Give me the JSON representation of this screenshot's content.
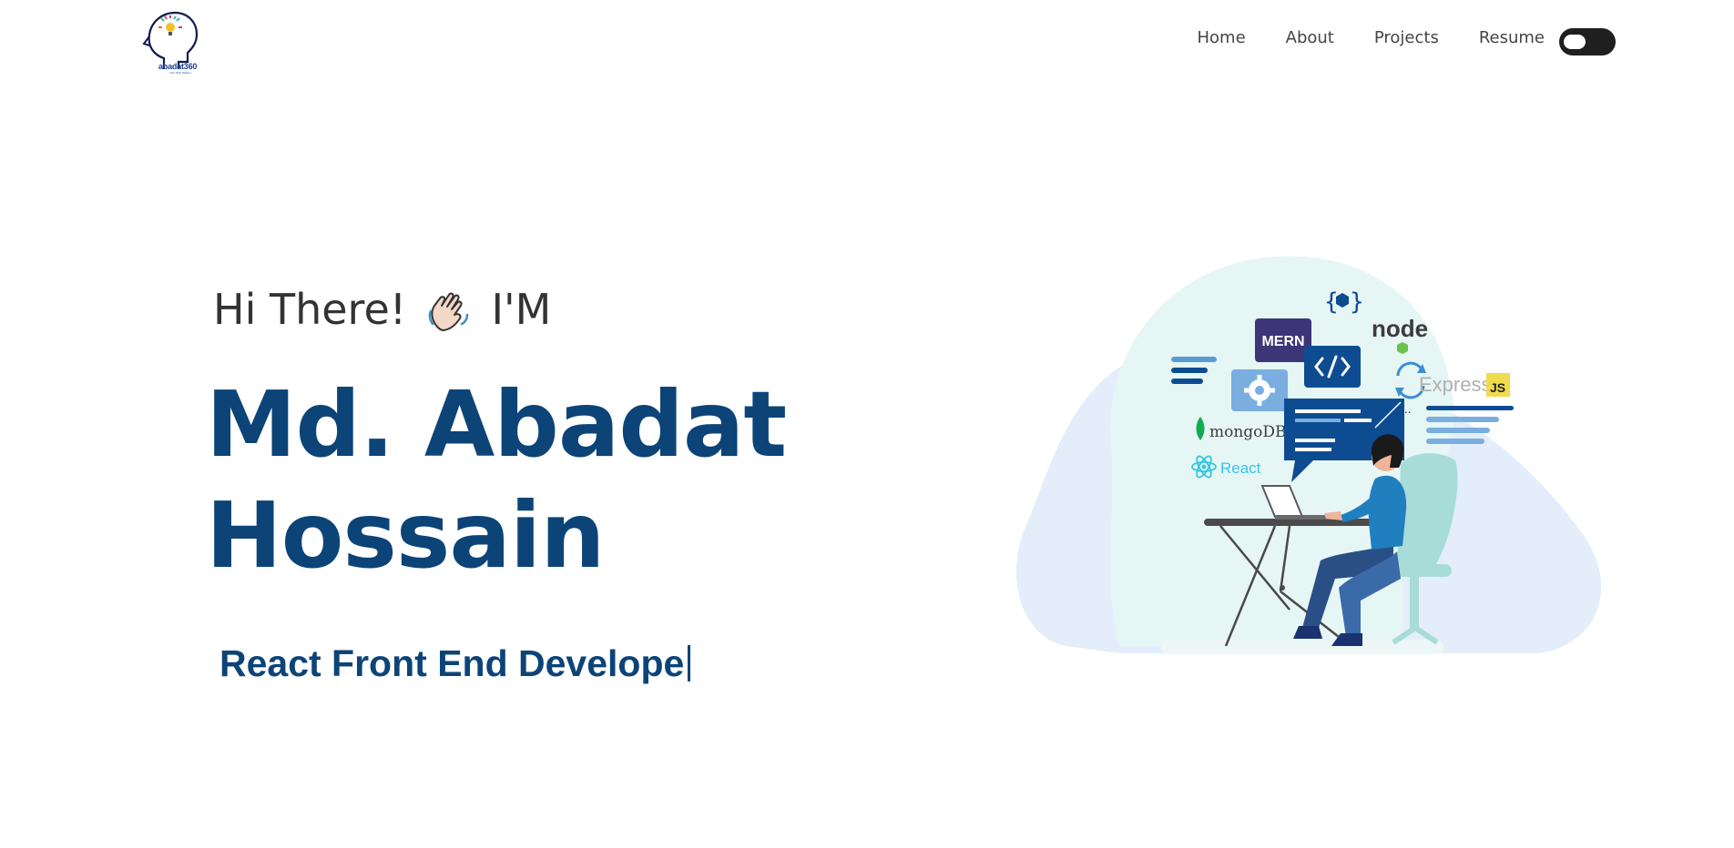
{
  "navbar": {
    "logo_text": "abadat360",
    "logo_sub": "Your Tech Partner",
    "links": [
      "Home",
      "About",
      "Projects",
      "Resume"
    ]
  },
  "hero": {
    "greeting_start": "Hi There!",
    "greeting_end": "I'M",
    "name_line1": "Md. Abadat",
    "name_line2": "Hossain",
    "typing_text": "React Front End Develope"
  },
  "illustration": {
    "mern_label": "MERN",
    "mongodb_label": "mongoDB.",
    "react_label": "React",
    "express_label": "Express",
    "js_label": "JS",
    "node_label": "node"
  },
  "colors": {
    "name": "#0c4478",
    "toggle": "#1f1f1f",
    "accent_blue": "#0e4c92"
  }
}
